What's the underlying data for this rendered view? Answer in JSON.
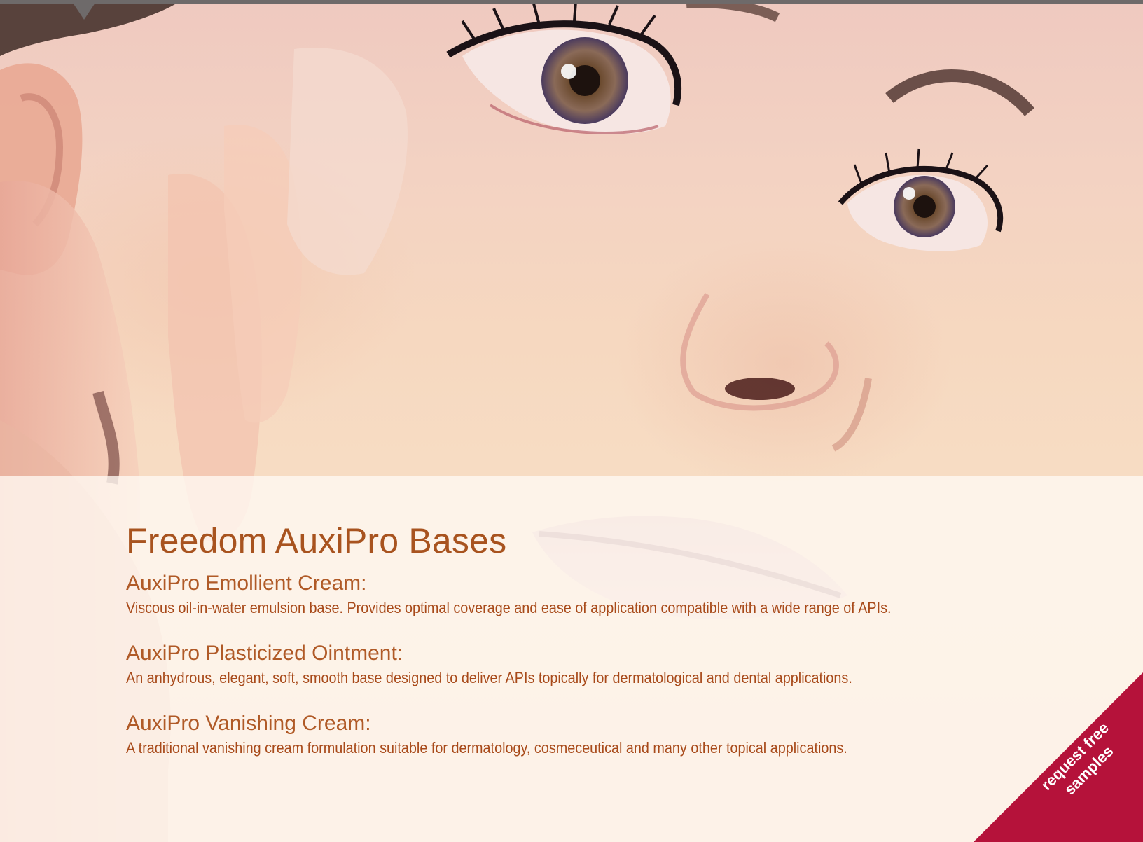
{
  "heading": "Freedom AuxiPro Bases",
  "products": [
    {
      "name": "AuxiPro Emollient Cream:",
      "description": "Viscous oil-in-water emulsion base. Provides optimal coverage and ease of application compatible with a wide range of APIs."
    },
    {
      "name": "AuxiPro Plasticized Ointment:",
      "description": "An anhydrous, elegant, soft, smooth base designed to deliver APIs topically for dermatological and dental applications."
    },
    {
      "name": "AuxiPro Vanishing Cream:",
      "description": "A traditional vanishing cream formulation suitable for dermatology, cosmeceutical and many other topical applications."
    }
  ],
  "cta": {
    "line1": "request free",
    "line2": "samples"
  },
  "colors": {
    "accent": "#b5123a",
    "text": "#a8531f",
    "topbar": "#6e6a6a"
  }
}
